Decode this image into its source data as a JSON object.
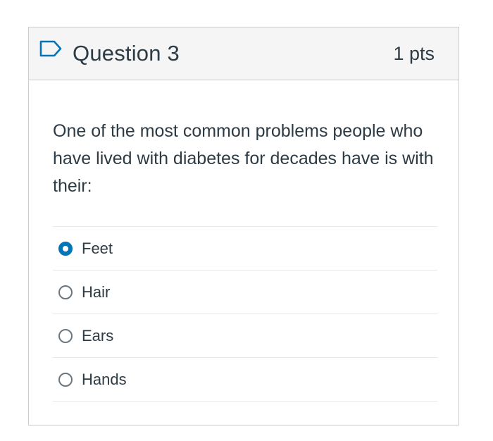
{
  "question": {
    "title": "Question 3",
    "points": "1 pts",
    "text": "One of the most common problems people who have lived with diabetes for decades have is with their:"
  },
  "answers": [
    {
      "label": "Feet",
      "selected": true
    },
    {
      "label": "Hair",
      "selected": false
    },
    {
      "label": "Ears",
      "selected": false
    },
    {
      "label": "Hands",
      "selected": false
    }
  ],
  "colors": {
    "accent": "#0374b5",
    "text": "#2d3b45",
    "header_bg": "#f5f5f5",
    "border": "#c7cdd1"
  },
  "icons": {
    "flag": "flag-icon"
  }
}
